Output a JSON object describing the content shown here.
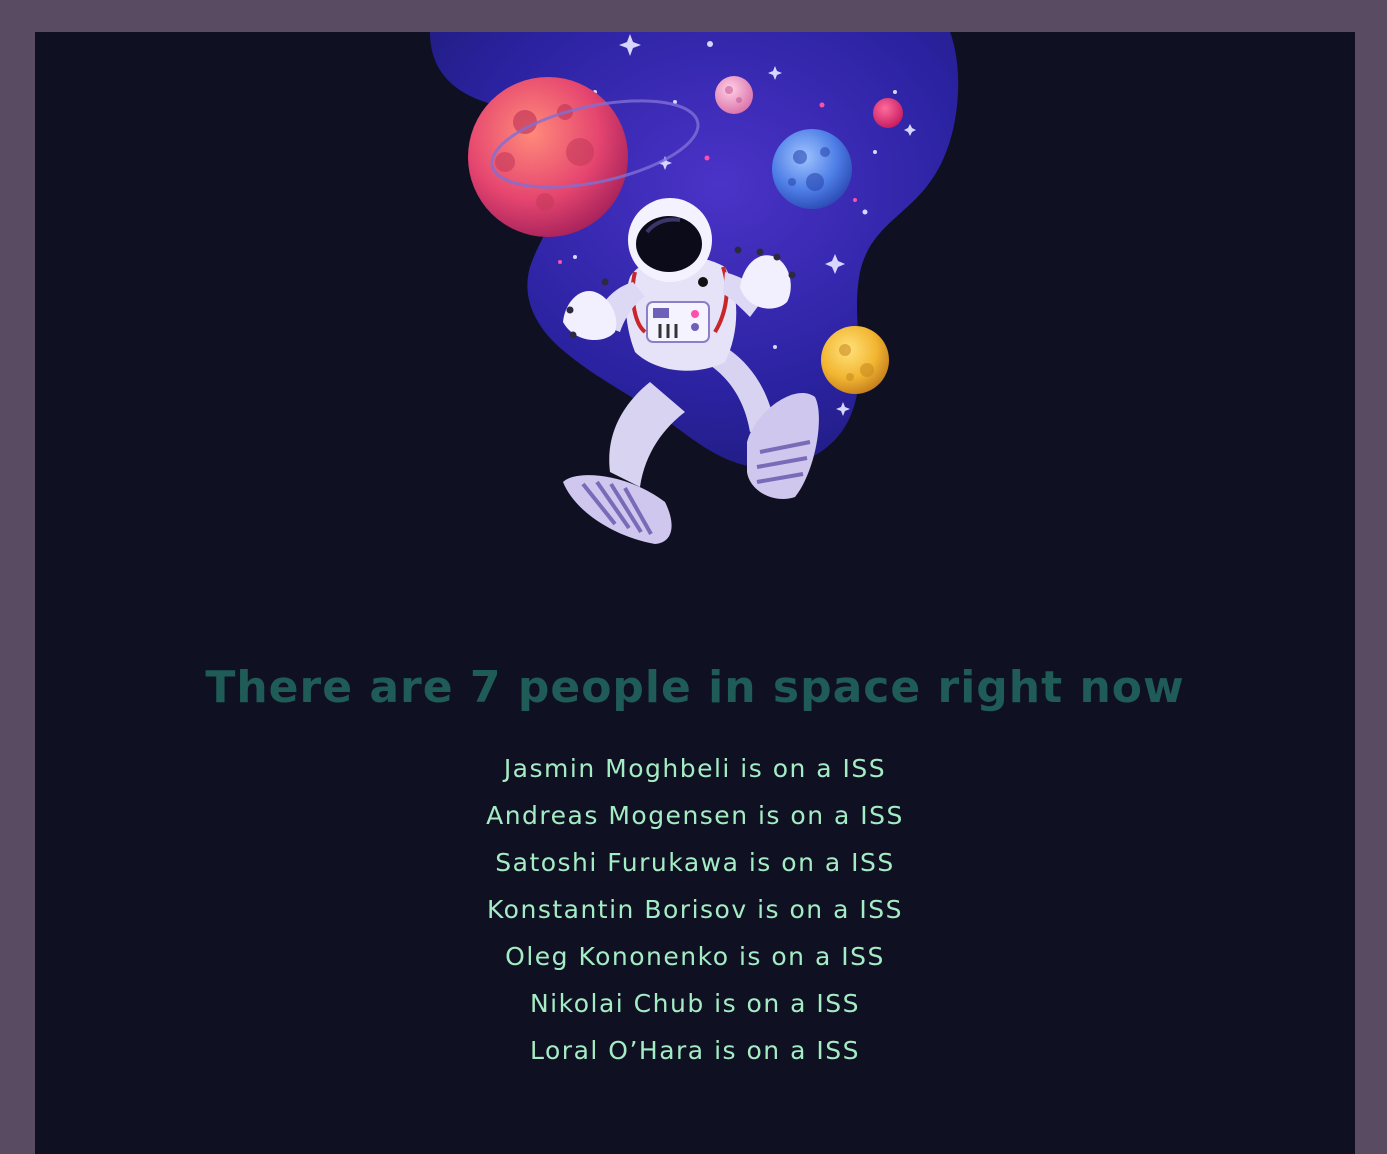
{
  "page": {
    "headline": "There are 7 people in space right now"
  },
  "people": [
    {
      "name": "Jasmin Moghbeli",
      "craft": "ISS",
      "text": "Jasmin Moghbeli is on a ISS"
    },
    {
      "name": "Andreas Mogensen",
      "craft": "ISS",
      "text": "Andreas Mogensen is on a ISS"
    },
    {
      "name": "Satoshi Furukawa",
      "craft": "ISS",
      "text": "Satoshi Furukawa is on a ISS"
    },
    {
      "name": "Konstantin Borisov",
      "craft": "ISS",
      "text": "Konstantin Borisov is on a ISS"
    },
    {
      "name": "Oleg Kononenko",
      "craft": "ISS",
      "text": "Oleg Kononenko is on a ISS"
    },
    {
      "name": "Nikolai Chub",
      "craft": "ISS",
      "text": "Nikolai Chub is on a ISS"
    },
    {
      "name": "Loral O’Hara",
      "craft": "ISS",
      "text": "Loral O’Hara is on a ISS"
    }
  ],
  "illustration": {
    "icon": "astronaut-in-space-illustration"
  },
  "colors": {
    "frame": "#584b62",
    "panel": "#0f1122",
    "headline": "#1f5c58",
    "list_text": "#a4ecc4"
  }
}
